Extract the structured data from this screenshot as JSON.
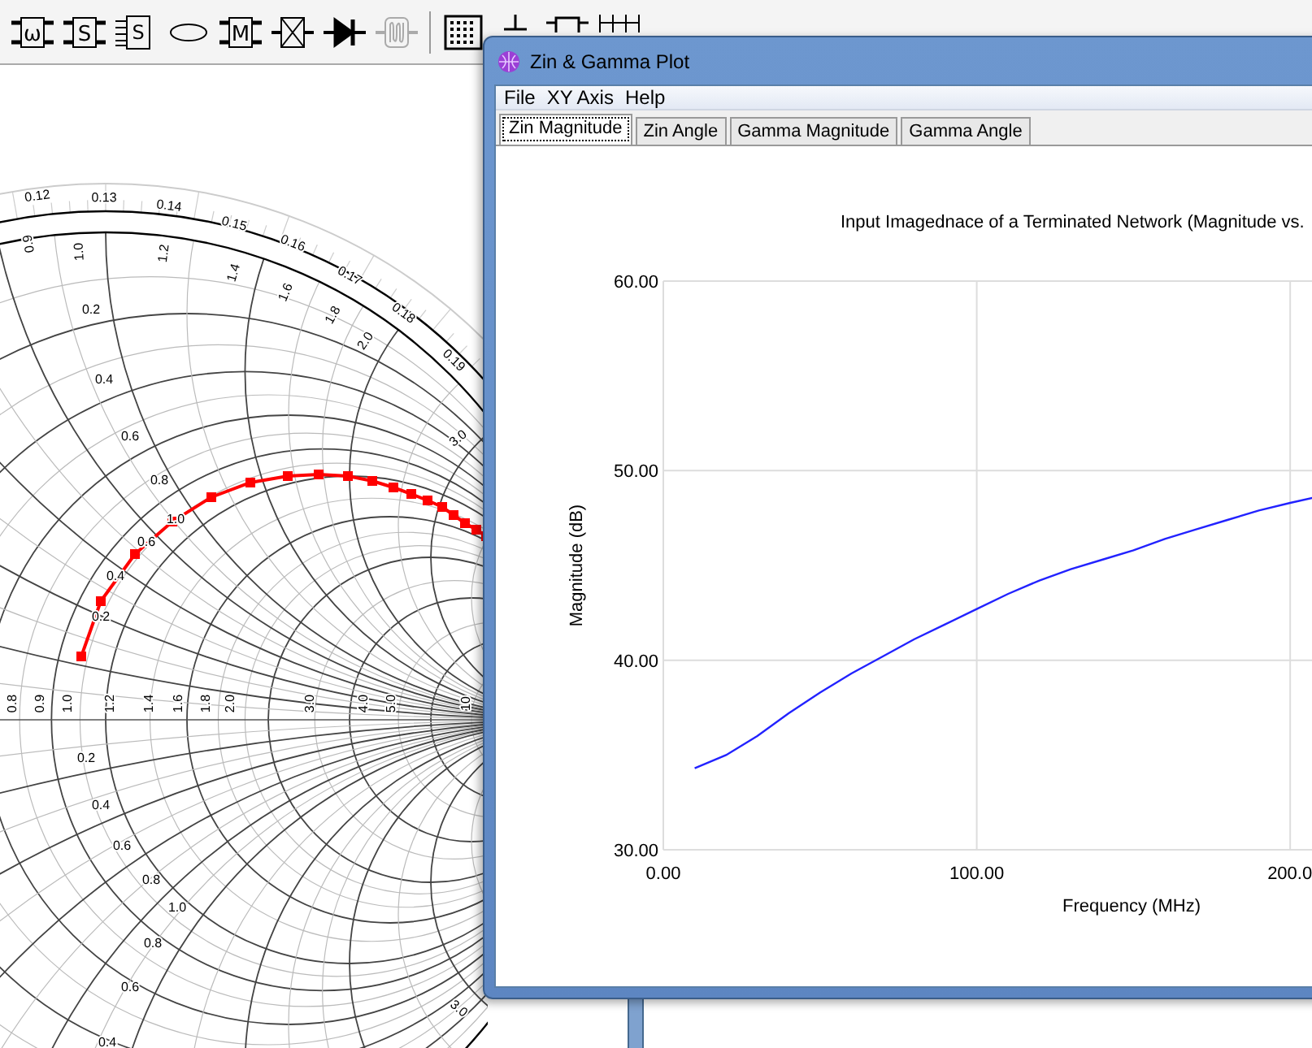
{
  "toolbar": [
    {
      "kind": "boxed",
      "label": "ω",
      "disabled": false
    },
    {
      "kind": "boxed",
      "label": "S",
      "disabled": false
    },
    {
      "kind": "multiport",
      "label": "S",
      "disabled": false
    },
    {
      "kind": "ellipse",
      "disabled": false
    },
    {
      "kind": "boxed",
      "label": "M",
      "disabled": false
    },
    {
      "kind": "crossed",
      "disabled": false
    },
    {
      "kind": "diode",
      "disabled": false
    },
    {
      "kind": "coil",
      "disabled": true
    },
    {
      "kind": "separator",
      "disabled": false
    },
    {
      "kind": "grid",
      "disabled": false
    },
    {
      "kind": "ground",
      "disabled": false
    },
    {
      "kind": "box",
      "disabled": false
    },
    {
      "kind": "lines",
      "disabled": false
    }
  ],
  "smith_chart": {
    "labels": [
      "0.12",
      "0.13",
      "0.14",
      "0.15",
      "0.16",
      "0.17",
      "0.18",
      "0.19",
      "0.9",
      "1.0",
      "1.2",
      "1.4",
      "1.6",
      "1.8",
      "2.0",
      "3.0",
      "0.2",
      "0.4",
      "0.6",
      "0.8",
      "1.0",
      "0.6",
      "0.4",
      "0.2",
      "0.8",
      "0.9",
      "1.0",
      "1.2",
      "1.4",
      "1.6",
      "1.8",
      "2.0",
      "3.0",
      "4.0",
      "5.0",
      "10",
      "0.2",
      "0.4",
      "0.6",
      "0.8",
      "1.0",
      "0.8",
      "0.6",
      "0.4",
      "3.0"
    ]
  },
  "window": {
    "title": "Zin & Gamma Plot",
    "menu": [
      "File",
      "XY Axis",
      "Help"
    ],
    "tabs": [
      {
        "label": "Zin Magnitude",
        "selected": true
      },
      {
        "label": "Zin Angle",
        "selected": false
      },
      {
        "label": "Gamma Magnitude",
        "selected": false
      },
      {
        "label": "Gamma Angle",
        "selected": false
      }
    ],
    "chart_data": {
      "type": "line",
      "title": "Input Imagednace of a Terminated Network (Magnitude vs.",
      "xlabel": "Frequency (MHz)",
      "ylabel": "Magnitude (dB)",
      "x": [
        10,
        20,
        30,
        40,
        50,
        60,
        70,
        80,
        90,
        100,
        110,
        120,
        130,
        140,
        150,
        160,
        170,
        180,
        190,
        200,
        208
      ],
      "series": [
        {
          "color": "#2222ff",
          "values": [
            34.3,
            35.0,
            36.0,
            37.2,
            38.3,
            39.3,
            40.2,
            41.1,
            41.9,
            42.7,
            43.5,
            44.2,
            44.8,
            45.3,
            45.8,
            46.4,
            46.9,
            47.4,
            47.9,
            48.3,
            48.6
          ]
        }
      ],
      "grid": true,
      "xlim": [
        0,
        208
      ],
      "ylim": [
        30,
        60
      ],
      "xticks": [
        {
          "value": 0,
          "label": "0.00"
        },
        {
          "value": 100,
          "label": "100.00"
        },
        {
          "value": 200,
          "label": "200.0"
        }
      ],
      "yticks": [
        {
          "value": 30,
          "label": "30.00"
        },
        {
          "value": 40,
          "label": "40.00"
        },
        {
          "value": 50,
          "label": "50.00"
        },
        {
          "value": 60,
          "label": "60.00"
        }
      ]
    }
  }
}
